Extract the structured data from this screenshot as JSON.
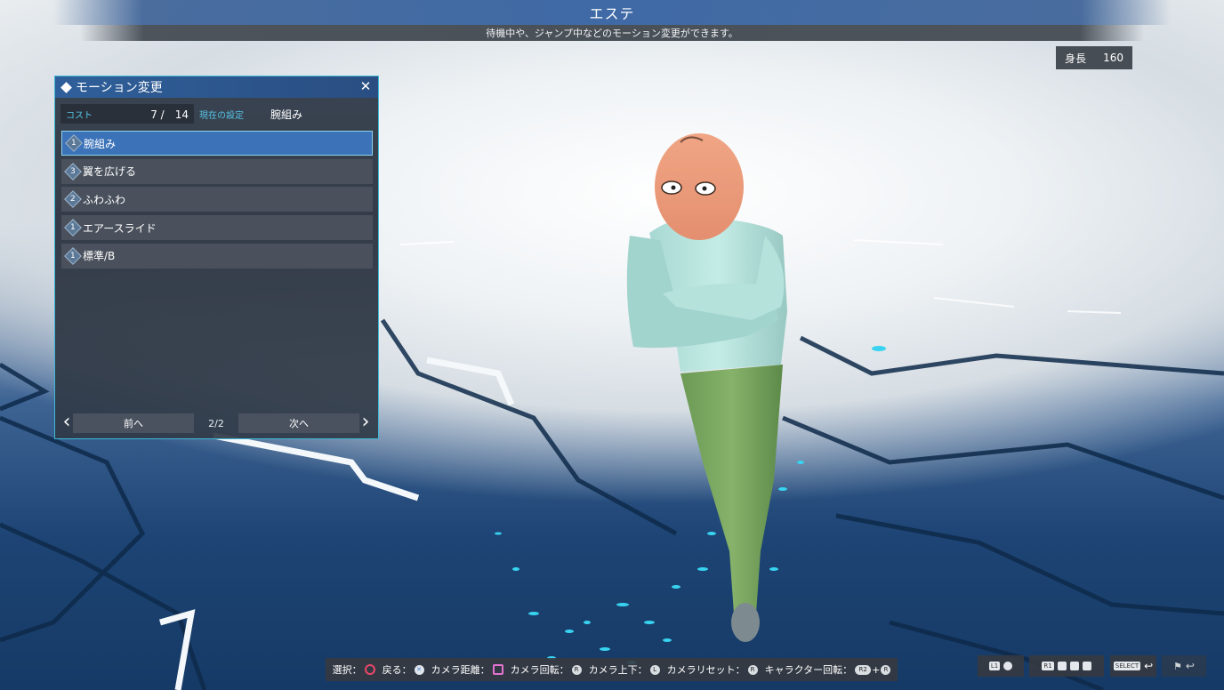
{
  "header": {
    "title": "エステ",
    "subtitle": "待機中や、ジャンプ中などのモーション変更ができます。"
  },
  "height_display": {
    "label": "身長",
    "value": "160"
  },
  "panel": {
    "title": "モーション変更",
    "cost_label": "コスト",
    "cost_value": "7 /　14",
    "current_label": "現在の設定",
    "current_value": "腕組み",
    "items": [
      {
        "cost": "1",
        "label": "腕組み",
        "selected": true
      },
      {
        "cost": "3",
        "label": "翼を広げる",
        "selected": false
      },
      {
        "cost": "2",
        "label": "ふわふわ",
        "selected": false
      },
      {
        "cost": "1",
        "label": "エアースライド",
        "selected": false
      },
      {
        "cost": "1",
        "label": "標準/B",
        "selected": false
      }
    ],
    "prev_label": "前へ",
    "next_label": "次へ",
    "page": "2/2"
  },
  "help_bar": [
    {
      "label": "選択：",
      "button": "circle"
    },
    {
      "label": "戻る：",
      "button": "cross"
    },
    {
      "label": "カメラ距離：",
      "button": "square"
    },
    {
      "label": "カメラ回転：",
      "button": "right-stick"
    },
    {
      "label": "カメラ上下：",
      "button": "left-stick"
    },
    {
      "label": "カメラリセット：",
      "button": "r3"
    },
    {
      "label": "キャラクター回転：",
      "button": "r2-plus-r"
    }
  ],
  "shortcuts": [
    {
      "key": "L1",
      "icon": "face-icon"
    },
    {
      "key": "R1",
      "icon": "clothes-icon"
    },
    {
      "key": "SELECT",
      "icon": "return-icon"
    },
    {
      "key": "",
      "icon": "flag-icon"
    }
  ],
  "colors": {
    "panel_border": "#3fb8d6",
    "panel_header": "#2f5f9a",
    "selected_item": "#3b72b8",
    "accent_text": "#56c4e4"
  }
}
